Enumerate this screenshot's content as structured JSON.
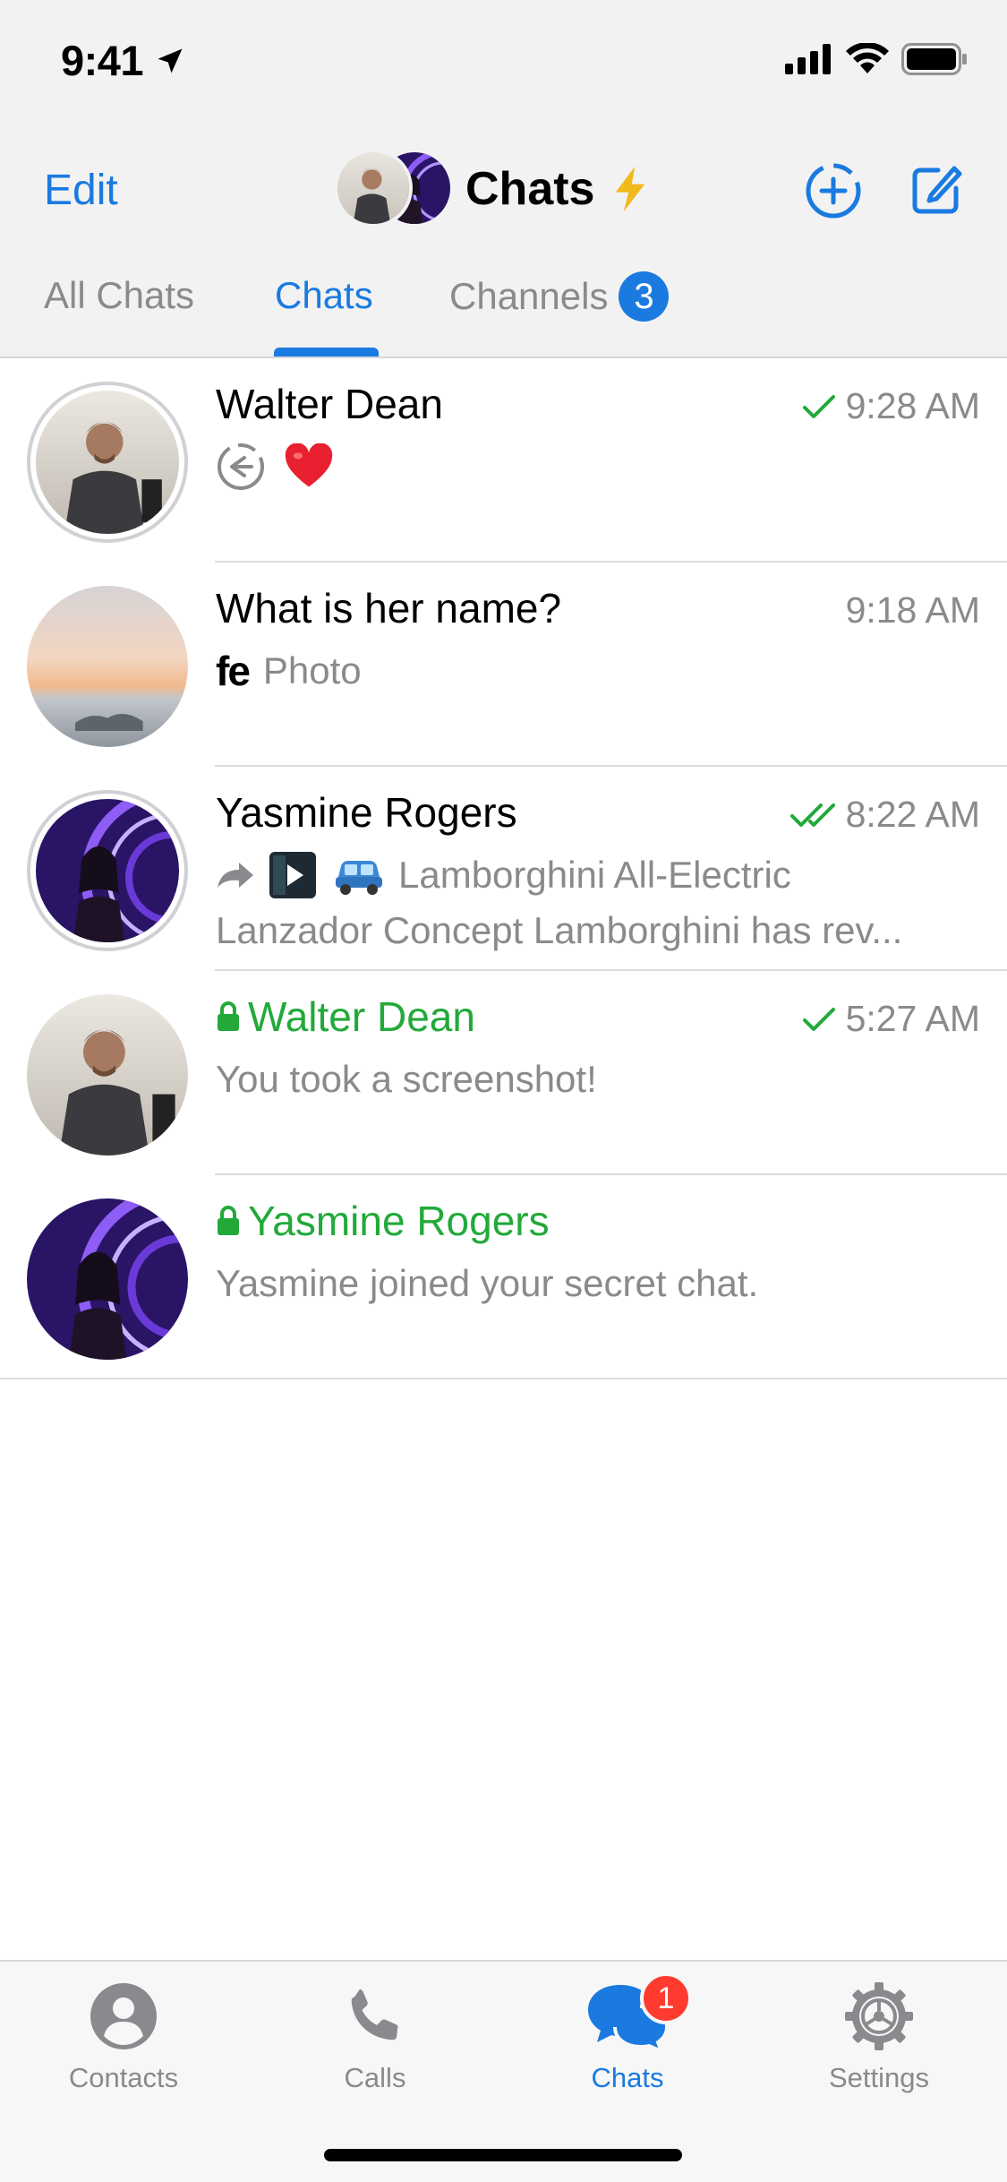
{
  "status": {
    "time": "9:41"
  },
  "header": {
    "edit": "Edit",
    "title": "Chats"
  },
  "tabs": [
    {
      "label": "All Chats"
    },
    {
      "label": "Chats"
    },
    {
      "label": "Channels",
      "badge": "3"
    }
  ],
  "chats": [
    {
      "name": "Walter Dean",
      "time": "9:28 AM",
      "status": "read-single",
      "preview_icon": "reply-icon",
      "preview_emoji": "❤️",
      "preview": ""
    },
    {
      "name": "What is her name?",
      "time": "9:18 AM",
      "preview_prefix": "fe",
      "preview": "Photo"
    },
    {
      "name": "Yasmine Rogers",
      "time": "8:22 AM",
      "status": "read-double",
      "preview_line1": "Lamborghini All-Electric",
      "preview_line2": "Lanzador Concept Lamborghini has rev..."
    },
    {
      "name": "Walter Dean",
      "time": "5:27 AM",
      "secret": true,
      "status": "read-single",
      "preview": "You took a screenshot!"
    },
    {
      "name": "Yasmine Rogers",
      "secret": true,
      "preview": "Yasmine joined your secret chat."
    }
  ],
  "tabbar": [
    {
      "label": "Contacts",
      "icon": "person-icon"
    },
    {
      "label": "Calls",
      "icon": "phone-icon"
    },
    {
      "label": "Chats",
      "icon": "chat-bubbles-icon",
      "badge": "1",
      "active": true
    },
    {
      "label": "Settings",
      "icon": "gear-icon"
    }
  ],
  "colors": {
    "accent": "#1a7ae0",
    "secret": "#22a93a",
    "badge": "#ff3b30"
  }
}
